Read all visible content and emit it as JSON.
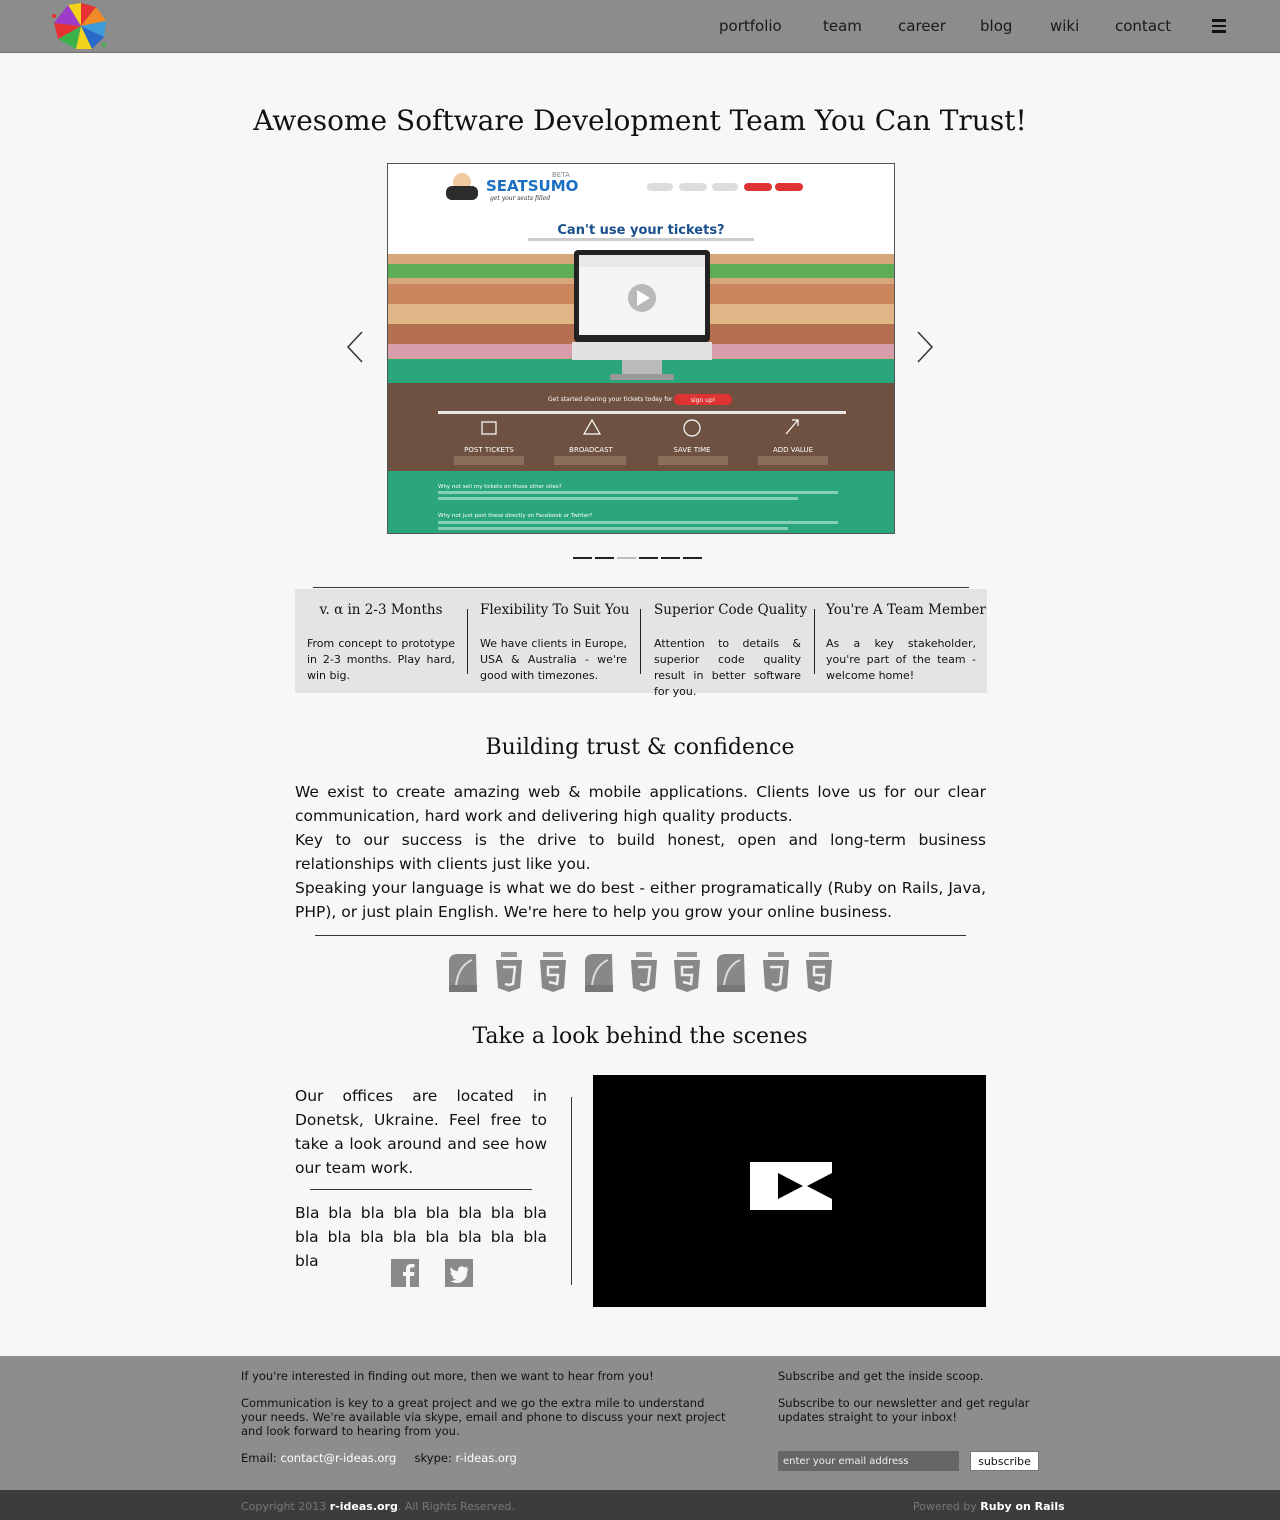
{
  "nav": {
    "items": [
      "portfolio",
      "team",
      "career",
      "blog",
      "wiki",
      "contact"
    ]
  },
  "hero": {
    "title": "Awesome Software Development Team You Can Trust!"
  },
  "slider": {
    "brand": "SEATSUMO",
    "brand_tag": "BETA",
    "brand_slogan": "get your seats filled",
    "headline": "Can't use your tickets?",
    "cta_text": "Get started sharing your tickets today for free",
    "cta_button": "sign up!",
    "features": [
      "POST TICKETS",
      "BROADCAST",
      "SAVE TIME",
      "ADD VALUE"
    ],
    "faq1": "Why not sell my tickets on those other sites?",
    "faq2": "Why not just post these directly on Facebook or Twitter?",
    "dot_count": 6,
    "active_dot": 2
  },
  "features": [
    {
      "title": "v. α in 2-3 Months",
      "text": "From concept to prototype in 2-3 months. Play hard, win big."
    },
    {
      "title": "Flexibility To Suit You",
      "text": "We have clients in Europe, USA & Australia - we're good with timezones."
    },
    {
      "title": "Superior Code Quality",
      "text": "Attention to details & superior code quality result in better software for you."
    },
    {
      "title": "You're A Team Member",
      "text": "As a key stakeholder, you're part of the team - welcome home!"
    }
  ],
  "about": {
    "title": "Building trust & confidence",
    "p1": "We exist to create amazing web & mobile applications. Clients love us for our clear communication, hard work and delivering high quality products.",
    "p2": "Key to our success is the drive to build honest, open and long-term business relationships with clients just like you.",
    "p3": "Speaking your language is what we do best - either programatically (Ruby on Rails, Java, PHP), or just plain English. We're here to help you grow your online business."
  },
  "tech_icons": [
    "rails-icon",
    "css3-icon",
    "html5-icon",
    "rails-icon",
    "css3-icon",
    "html5-icon",
    "rails-icon",
    "css3-icon",
    "html5-icon"
  ],
  "behind": {
    "title": "Take a look behind the scenes",
    "office": "Our offices are located in Donetsk, Ukraine. Feel free to take a look around and see how our team work.",
    "bla": "Bla bla bla bla bla bla bla bla bla bla bla bla bla bla bla bla bla"
  },
  "footer": {
    "left_p1": "If you're interested in finding out more, then we want to hear from you!",
    "left_p2": "Communication is key to a great project and we go the extra mile to understand your needs. We're available via skype, email and phone to discuss your next project and look forward to hearing from you.",
    "email_label": "Email:",
    "email": "contact@r-ideas.org",
    "skype_label": "skype:",
    "skype": "r-ideas.org",
    "right_p1": "Subscribe and get the inside scoop.",
    "right_p2": "Subscribe to our newsletter and get regular updates straight to your inbox!",
    "email_placeholder": "enter your email address",
    "subscribe": "subscribe"
  },
  "bottom": {
    "copy_pre": "Copyright 2013",
    "site": "r-ideas.org",
    "copy_post": ". All Rights Reserved.",
    "powered_pre": "Powered by",
    "powered": "Ruby on Rails"
  },
  "colors": {
    "header": "#8c8c8c",
    "feature_bg": "#e4e4e4",
    "footer": "#8d8d8d",
    "bottom_bar": "#3c3c3c",
    "slider_green": "#2aa57c",
    "slider_brown": "#6e5140"
  }
}
